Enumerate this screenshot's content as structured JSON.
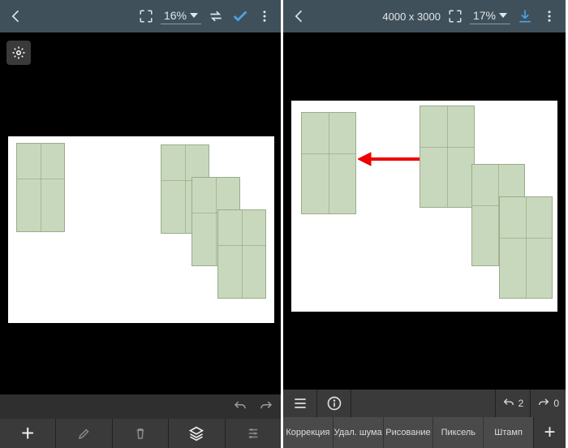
{
  "left": {
    "zoom_label": "16%",
    "dimensions": "",
    "bottom_buttons": [
      "add",
      "edit",
      "delete",
      "layers",
      "settings"
    ]
  },
  "right": {
    "dimensions": "4000 x 3000",
    "zoom_label": "17%",
    "undo_count": "2",
    "redo_count": "0",
    "tools": [
      "Коррекция",
      "Удал. шума",
      "Рисование",
      "Пиксель",
      "Штамп"
    ]
  }
}
